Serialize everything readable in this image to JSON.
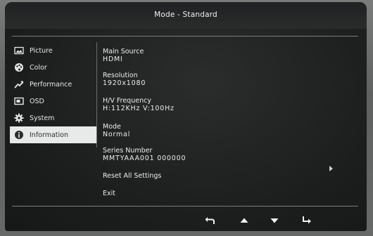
{
  "title": "Mode - Standard",
  "sidebar": {
    "items": [
      {
        "label": "Picture",
        "icon": "picture-icon",
        "active": false
      },
      {
        "label": "Color",
        "icon": "palette-icon",
        "active": false
      },
      {
        "label": "Performance",
        "icon": "trend-icon",
        "active": false
      },
      {
        "label": "OSD",
        "icon": "osd-icon",
        "active": false
      },
      {
        "label": "System",
        "icon": "gear-icon",
        "active": false
      },
      {
        "label": "Information",
        "icon": "info-icon",
        "active": true
      }
    ]
  },
  "info": {
    "main_source_label": "Main Source",
    "main_source_value": "HDMI",
    "resolution_label": "Resolution",
    "resolution_value": "1920x1080",
    "frequency_label": "H/V Frequency",
    "frequency_value": "H:112KHz V:100Hz",
    "mode_label": "Mode",
    "mode_value": "Normal",
    "serial_label": "Series Number",
    "serial_value": "MMTYAAA001 000000",
    "reset_label": "Reset All Settings",
    "exit_label": "Exit"
  },
  "bottom_buttons": [
    "back-icon",
    "up-arrow-icon",
    "down-arrow-icon",
    "enter-icon"
  ],
  "colors": {
    "active_bg": "#e8eaea",
    "text": "#ececec",
    "panel": "#1e2020"
  }
}
